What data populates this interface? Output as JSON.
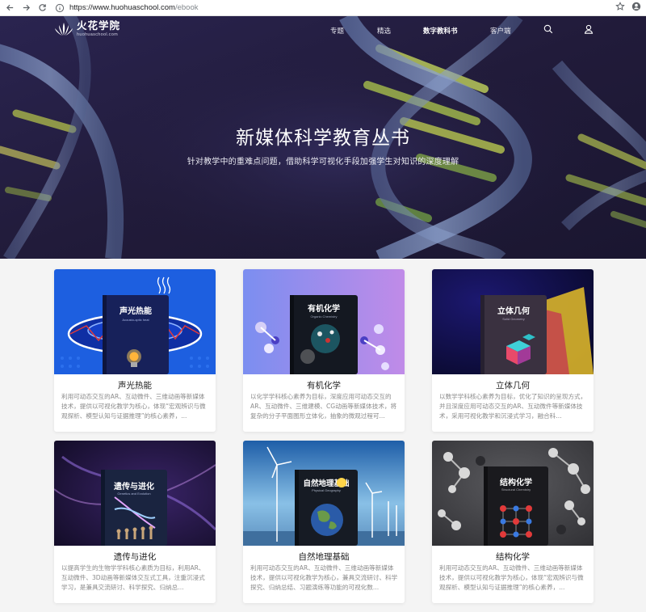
{
  "browser": {
    "url_host": "https://www.huohuaschool.com",
    "url_path": "/ebook"
  },
  "brand": {
    "name": "火花学院",
    "domain": "huohuaschool.com"
  },
  "nav": {
    "items": [
      {
        "label": "专题"
      },
      {
        "label": "精选"
      },
      {
        "label": "数字教科书"
      },
      {
        "label": "客户端"
      }
    ]
  },
  "hero": {
    "title": "新媒体科学教育丛书",
    "subtitle": "针对教学中的重难点问题，借助科学可视化手段加强学生对知识的深度理解"
  },
  "books": [
    {
      "title": "声光热能",
      "cover_title": "声光热能",
      "cover_sub": "Acousto-optic heat",
      "desc": "利用可动态交互的AR、互动微件、三维动画等新媒体技术，提供以可视化教学为核心，体现“宏观辨识与微观探析、模型认知与证据推理”的核心素养，..."
    },
    {
      "title": "有机化学",
      "cover_title": "有机化学",
      "cover_sub": "Organic Chemistry",
      "desc": "以化学学科核心素养为目标，深度应用可动态交互的AR、互动微件、三维建模、CG动画等新媒体技术，将复杂的分子平面图形立体化，抽象的微观过程可..."
    },
    {
      "title": "立体几何",
      "cover_title": "立体几何",
      "cover_sub": "Solid Geometry",
      "desc": "以数学学科核心素养为目标，优化了知识的呈现方式，并且深度应用可动态交互的AR、互动微件等新媒体技术，采用可视化教学和沉浸式学习，融合科..."
    },
    {
      "title": "遗传与进化",
      "cover_title": "遗传与进化",
      "cover_sub": "Genetics and Evolution",
      "desc": "以提高学生的生物学学科核心素质为目标，利用AR、互动微件、3D动画等新媒体交互式工具，注重沉浸式学习，是兼具交流研讨、科学探究、归纳总..."
    },
    {
      "title": "自然地理基础",
      "cover_title": "自然地理基础",
      "cover_sub": "Physical Geography",
      "desc": "利用可动态交互的AR、互动微件、三维动画等新媒体技术，提供以可视化教学为核心，兼具交流研讨、科学探究、归纳总结、习题演练等功能的可视化数..."
    },
    {
      "title": "结构化学",
      "cover_title": "结构化学",
      "cover_sub": "Structural Chemistry",
      "desc": "利用可动态交互的AR、互动微件、三维动画等新媒体技术，提供以可视化教学为核心，体现“宏观辨识与微观探析、模型认知与证据推理”的核心素养，..."
    }
  ]
}
